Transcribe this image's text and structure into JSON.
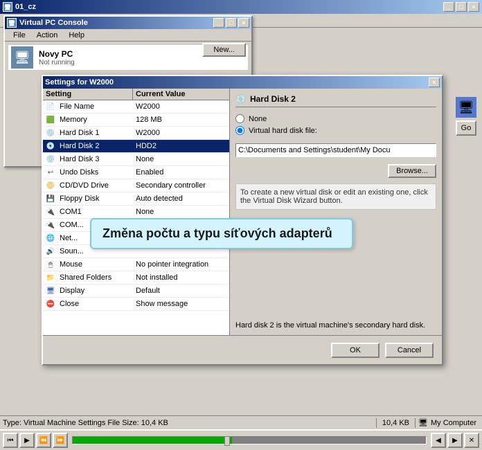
{
  "outerWindow": {
    "title": "01_cz",
    "buttons": [
      "_",
      "□",
      "×"
    ]
  },
  "menuBar": {
    "items": [
      "File",
      "Action",
      "Help"
    ]
  },
  "vpcWindow": {
    "title": "Virtual PC Console",
    "menu": [
      "File",
      "Action",
      "Help"
    ],
    "vmList": [
      {
        "name": "Novy PC",
        "status": "Not running"
      }
    ],
    "newButton": "New..."
  },
  "settingsDialog": {
    "title": "Settings for W2000",
    "closeBtn": "×",
    "columns": {
      "setting": "Setting",
      "value": "Current Value"
    },
    "rows": [
      {
        "icon": "📄",
        "name": "File Name",
        "value": "W2000",
        "selected": false
      },
      {
        "icon": "💾",
        "name": "Memory",
        "value": "128 MB",
        "selected": false
      },
      {
        "icon": "💿",
        "name": "Hard Disk 1",
        "value": "W2000",
        "selected": false
      },
      {
        "icon": "💿",
        "name": "Hard Disk 2",
        "value": "HDD2",
        "selected": true
      },
      {
        "icon": "💿",
        "name": "Hard Disk 3",
        "value": "None",
        "selected": false
      },
      {
        "icon": "⏪",
        "name": "Undo Disks",
        "value": "Enabled",
        "selected": false
      },
      {
        "icon": "📀",
        "name": "CD/DVD Drive",
        "value": "Secondary controller",
        "selected": false
      },
      {
        "icon": "💾",
        "name": "Floppy Disk",
        "value": "Auto detected",
        "selected": false
      },
      {
        "icon": "🔌",
        "name": "COM1",
        "value": "None",
        "selected": false
      },
      {
        "icon": "🔌",
        "name": "COM...",
        "value": "",
        "selected": false
      },
      {
        "icon": "🌐",
        "name": "Net...",
        "value": "",
        "selected": false
      },
      {
        "icon": "🔊",
        "name": "Soun...",
        "value": "",
        "selected": false
      },
      {
        "icon": "🖱",
        "name": "Mouse",
        "value": "No pointer integration",
        "selected": false
      },
      {
        "icon": "📁",
        "name": "Shared Folders",
        "value": "Not installed",
        "selected": false
      },
      {
        "icon": "🖥",
        "name": "Display",
        "value": "Default",
        "selected": false
      },
      {
        "icon": "❌",
        "name": "Close",
        "value": "Show message",
        "selected": false
      }
    ],
    "rightPanel": {
      "title": "Hard Disk 2",
      "options": [
        {
          "label": "None",
          "selected": false
        },
        {
          "label": "Virtual hard disk file:",
          "selected": true
        }
      ],
      "pathValue": "C:\\Documents and Settings\\student\\My Docu",
      "browseBtn": "Browse...",
      "wizardDesc": "To create a new virtual disk or edit an existing one, click the Virtual Disk Wizard button.",
      "bottomDesc": "Hard disk 2 is the virtual machine's secondary hard disk."
    },
    "footer": {
      "okBtn": "OK",
      "cancelBtn": "Cancel"
    }
  },
  "tooltip": {
    "text": "Změna počtu a typu síťových adapterů"
  },
  "goButton": "Go",
  "statusBar": {
    "left": "Type: Virtual Machine Settings File Size: 10,4 KB",
    "right": "10,4 KB",
    "computer": "My Computer"
  },
  "bottomToolbar": {
    "buttons": [
      "⏮",
      "▶",
      "⏪",
      "⏩"
    ],
    "rightButtons": [
      "◀",
      "▶",
      "✕"
    ]
  }
}
